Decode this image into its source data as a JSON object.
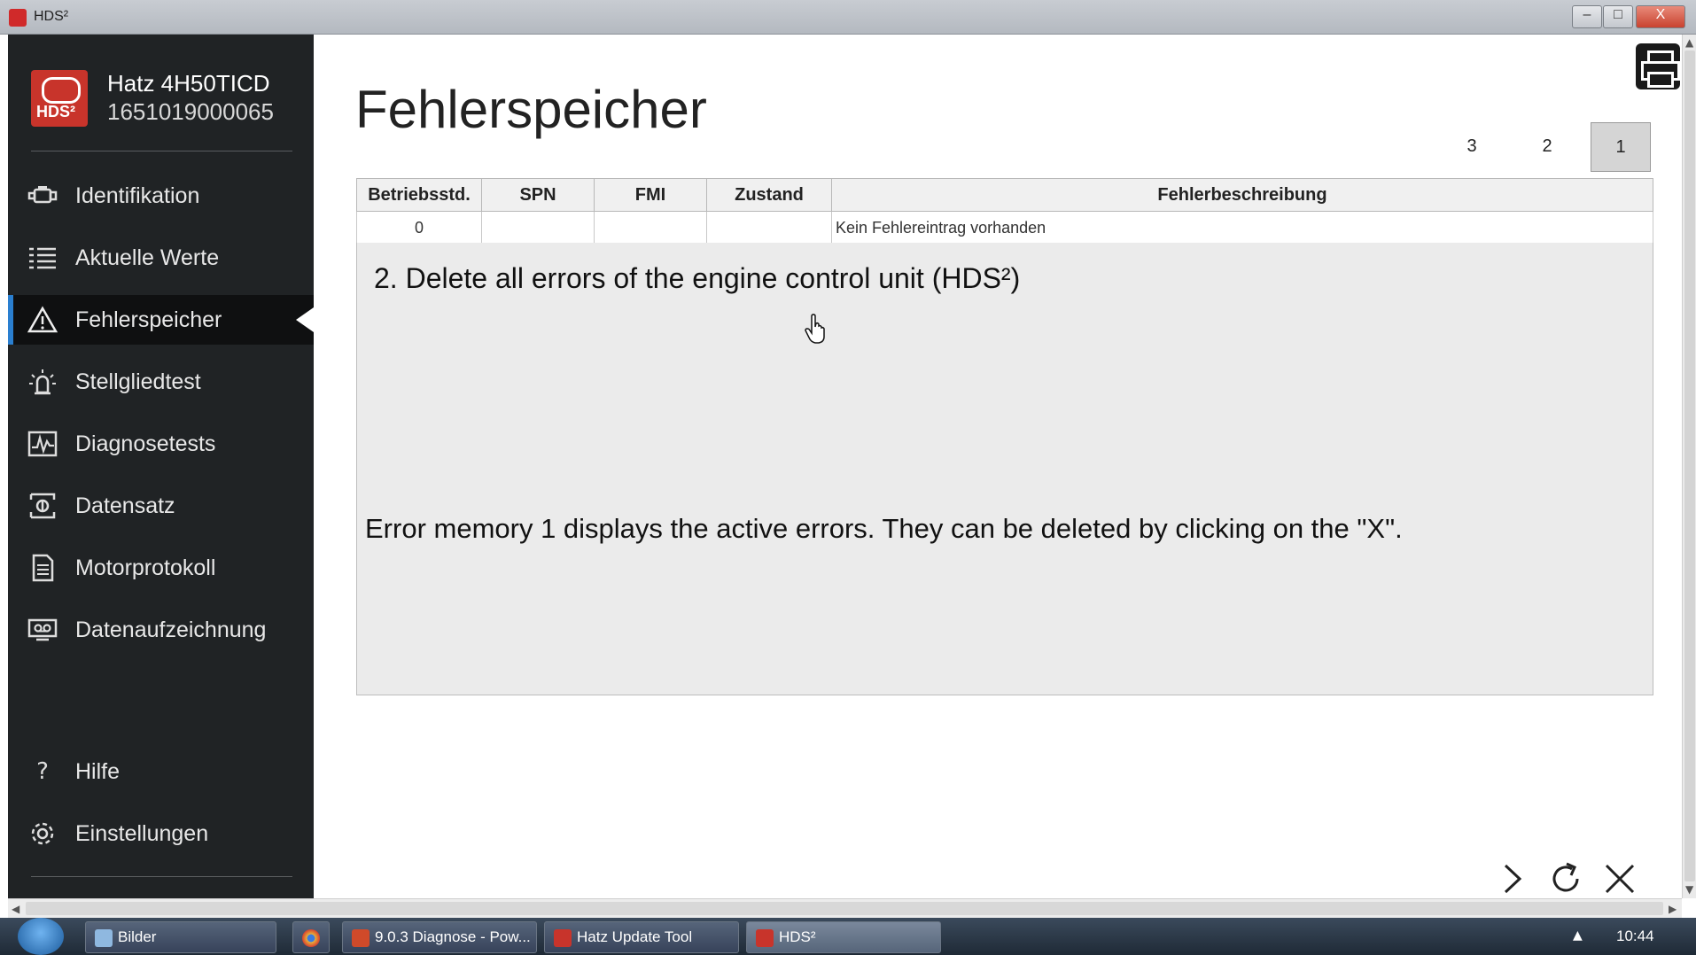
{
  "window": {
    "title": "HDS²",
    "min_label": "–",
    "max_label": "□",
    "close_label": "X"
  },
  "device": {
    "name": "Hatz 4H50TICD",
    "serial": "1651019000065",
    "logo_text": "HDS²"
  },
  "sidebar": {
    "items": [
      {
        "label": "Identifikation",
        "icon": "engine-icon",
        "active": false
      },
      {
        "label": "Aktuelle Werte",
        "icon": "list-icon",
        "active": false
      },
      {
        "label": "Fehlerspeicher",
        "icon": "warning-icon",
        "active": true
      },
      {
        "label": "Stellgliedtest",
        "icon": "lamp-icon",
        "active": false
      },
      {
        "label": "Diagnosetests",
        "icon": "graph-icon",
        "active": false
      },
      {
        "label": "Datensatz",
        "icon": "dataset-icon",
        "active": false
      },
      {
        "label": "Motorprotokoll",
        "icon": "document-icon",
        "active": false
      },
      {
        "label": "Datenaufzeichnung",
        "icon": "recorder-icon",
        "active": false
      }
    ],
    "bottom_items": [
      {
        "label": "Hilfe",
        "icon": "help-icon"
      },
      {
        "label": "Einstellungen",
        "icon": "gear-icon"
      }
    ]
  },
  "main": {
    "title": "Fehlerspeicher",
    "page_tabs": [
      "3",
      "2",
      "1"
    ],
    "active_page": "1",
    "table": {
      "headers": [
        "Betriebsstd.",
        "SPN",
        "FMI",
        "Zustand",
        "Fehlerbeschreibung"
      ],
      "rows": [
        [
          "0",
          "",
          "",
          "",
          "Kein Fehlereintrag vorhanden"
        ]
      ]
    },
    "overlay_step": "2. Delete all errors of the engine control unit (HDS²)",
    "overlay_note": "Error memory 1 displays the active errors. They can be deleted by clicking on the \"X\"."
  },
  "taskbar": {
    "items": [
      "Bilder",
      "9.0.3 Diagnose - Pow...",
      "Hatz Update Tool",
      "HDS²"
    ],
    "clock": "10:44"
  },
  "colors": {
    "sidebar_bg": "#202325",
    "accent": "#2a7fd0",
    "brand_red": "#c8342b"
  }
}
